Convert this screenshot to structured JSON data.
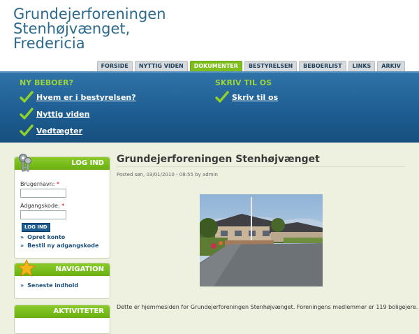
{
  "site": {
    "title_lines": [
      "Grundejerforeningen",
      "Stenhøjvænget,",
      "Fredericia"
    ]
  },
  "primary_nav": {
    "tabs": [
      {
        "label": "FORSIDE"
      },
      {
        "label": "NYTTIG VIDEN"
      },
      {
        "label": "DOKUMENTER",
        "active": true
      },
      {
        "label": "BESTYRELSEN"
      },
      {
        "label": "BEBOERLIST"
      },
      {
        "label": "LINKS"
      },
      {
        "label": "ARKIV"
      }
    ]
  },
  "banner": {
    "left_heading": "NY BEBOER?",
    "left_links": [
      "Hvem er i bestyrelsen?",
      "Nyttig viden",
      "Vedtægter"
    ],
    "right_heading": "SKRIV TIL OS",
    "right_links": [
      "Skriv til os"
    ]
  },
  "login_block": {
    "title": "LOG IND",
    "username_label": "Brugernavn:",
    "password_label": "Adgangskode:",
    "required_mark": "*",
    "submit_label": "LOG IND",
    "links": [
      "Opret konto",
      "Bestil ny adgangskode"
    ],
    "bullet": "»"
  },
  "navigation_block": {
    "title": "NAVIGATION",
    "links": [
      "Seneste indhold"
    ]
  },
  "activities_block": {
    "title": "AKTIVITETER"
  },
  "node": {
    "title": "Grundejerforeningen Stenhøjvænget",
    "meta": "Posted søn, 03/01/2010 - 08:55 by admin",
    "body": "Dette er hjemmesiden for Grundejerforeningen Stenhøjvænget. Foreningens medlemmer er 119 boligejere."
  },
  "colors": {
    "accent_green": "#7fbf1d",
    "banner_blue": "#1d5c90",
    "title_blue": "#2b6a8e"
  },
  "icons": {
    "check": "check-icon",
    "keys": "keys-icon",
    "star": "star-icon"
  }
}
